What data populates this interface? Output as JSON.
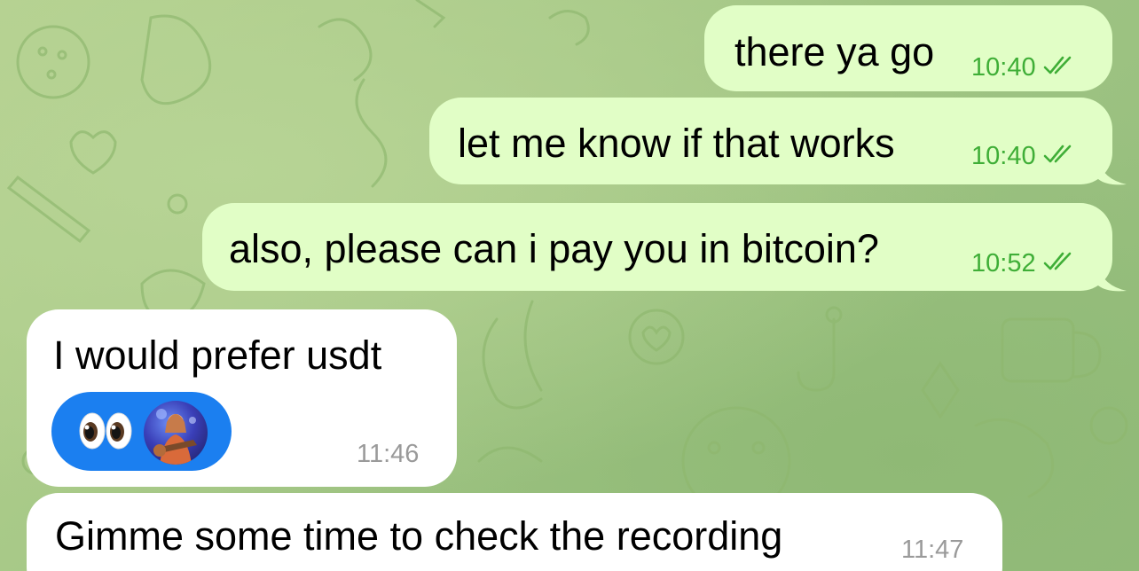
{
  "chat": {
    "messages": [
      {
        "direction": "outgoing",
        "text": "there ya go",
        "time": "10:40",
        "status": "read"
      },
      {
        "direction": "outgoing",
        "text": "let me know if that works",
        "time": "10:40",
        "status": "read"
      },
      {
        "direction": "outgoing",
        "text": "also, please can i pay you in bitcoin?",
        "time": "10:52",
        "status": "read"
      },
      {
        "direction": "incoming",
        "text": "I would prefer usdt",
        "time": "11:46",
        "reaction": {
          "emoji_icon": "eyes-emoji-icon",
          "reactor": "avatar"
        }
      },
      {
        "direction": "incoming",
        "text": "Gimme some time to check the recording",
        "time": "11:47"
      }
    ]
  },
  "colors": {
    "outgoing_bubble": "#e1fec6",
    "incoming_bubble": "#ffffff",
    "outgoing_time": "#3fae37",
    "incoming_time": "#9a9a9a",
    "reaction_pill": "#1b7ff0",
    "wallpaper": "#a9c98a"
  }
}
